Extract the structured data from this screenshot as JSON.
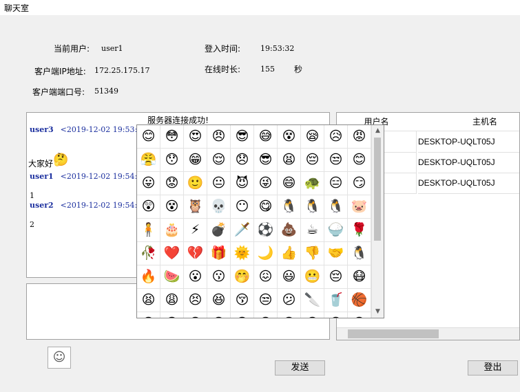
{
  "window": {
    "title": "聊天室"
  },
  "info": {
    "current_user_label": "当前用户:",
    "current_user_value": "user1",
    "login_time_label": "登入时间:",
    "login_time_value": "19:53:32",
    "client_ip_label": "客户端IP地址:",
    "client_ip_value": "172.25.175.17",
    "online_duration_label": "在线时长:",
    "online_duration_value": "155",
    "online_duration_unit": "秒",
    "client_port_label": "客户端端口号:",
    "client_port_value": "51349"
  },
  "chat": {
    "status": "服务器连接成功!",
    "messages": [
      {
        "user": "user3",
        "time": "<2019-12-02 19:53:",
        "body": "大家好"
      },
      {
        "user": "user1",
        "time": "<2019-12-02 19:54:",
        "body": "1"
      },
      {
        "user": "user2",
        "time": "<2019-12-02 19:54:",
        "body": "2"
      }
    ]
  },
  "users_table": {
    "headers": [
      "用户名",
      "主机名"
    ],
    "rows": [
      {
        "username": "",
        "hostname": "DESKTOP-UQLT05J"
      },
      {
        "username": "",
        "hostname": "DESKTOP-UQLT05J"
      },
      {
        "username": "",
        "hostname": "DESKTOP-UQLT05J"
      }
    ]
  },
  "emoji_panel": {
    "emojis": [
      "😊",
      "😳",
      "😍",
      "😠",
      "😎",
      "😅",
      "😵",
      "😪",
      "😥",
      "😡",
      "😤",
      "😯",
      "😁",
      "😌",
      "😞",
      "😎",
      "😫",
      "😔",
      "😒",
      "😊",
      "😛",
      "😟",
      "🙂",
      "😐",
      "😈",
      "😜",
      "😄",
      "🐢",
      "😑",
      "😏",
      "😲",
      "😵",
      "🦉",
      "💀",
      "😶",
      "😋",
      "🐧",
      "🐧",
      "🐧",
      "🐷",
      "🧍",
      "🎂",
      "⚡",
      "💣",
      "🗡️",
      "⚽",
      "💩",
      "☕",
      "🍚",
      "🌹",
      "🥀",
      "❤️",
      "💔",
      "🎁",
      "🌞",
      "🌙",
      "👍",
      "👎",
      "🤝",
      "🐧",
      "🔥",
      "🍉",
      "😮",
      "😗",
      "🤭",
      "😖",
      "😃",
      "😬",
      "😔",
      "😷",
      "😫",
      "😩",
      "😣",
      "😆",
      "😚",
      "😒",
      "😕",
      "🔪",
      "🥤",
      "🏀",
      "😐",
      "😐",
      "😐",
      "😐",
      "😐",
      "😐",
      "😐",
      "😐",
      "😐",
      "😐"
    ]
  },
  "buttons": {
    "send": "发送",
    "logout": "登出",
    "emoji": "☺"
  }
}
